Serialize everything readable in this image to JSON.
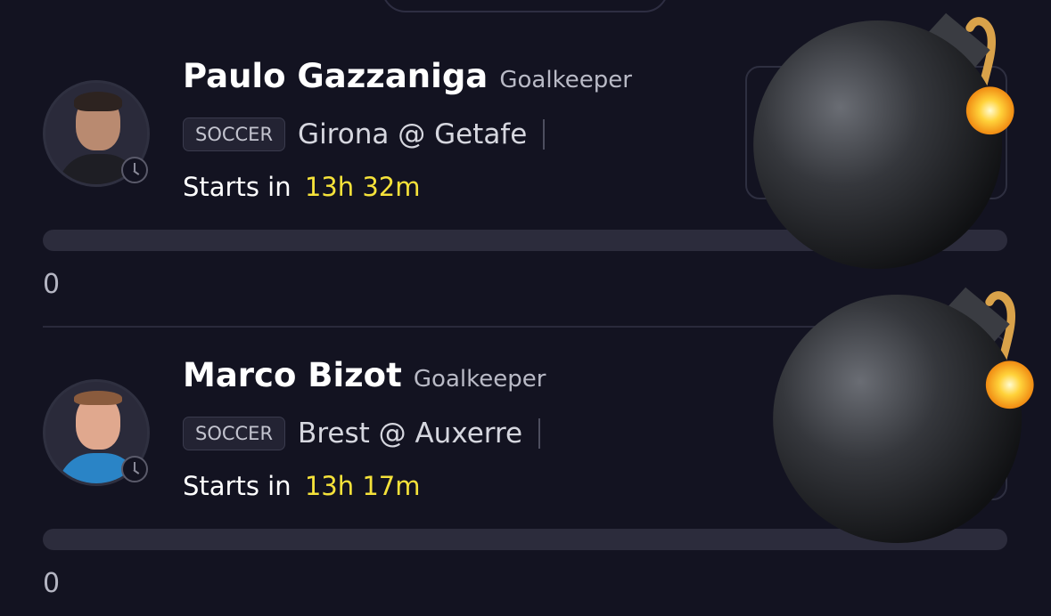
{
  "cards": [
    {
      "player_name": "Paulo Gazzaniga",
      "position": "Goalkeeper",
      "sport": "SOCCER",
      "match": "Girona @ Getafe",
      "starts_label": "Starts in",
      "countdown": "13h 32m",
      "progress_percent": 0,
      "progress_value": "0",
      "emoji": "bomb"
    },
    {
      "player_name": "Marco Bizot",
      "position": "Goalkeeper",
      "sport": "SOCCER",
      "match": "Brest @ Auxerre",
      "starts_label": "Starts in",
      "countdown": "13h 17m",
      "progress_percent": 0,
      "progress_value": "0",
      "emoji": "bomb"
    }
  ],
  "colors": {
    "background": "#131321",
    "countdown": "#f5e23a",
    "track": "#2c2c3c"
  }
}
